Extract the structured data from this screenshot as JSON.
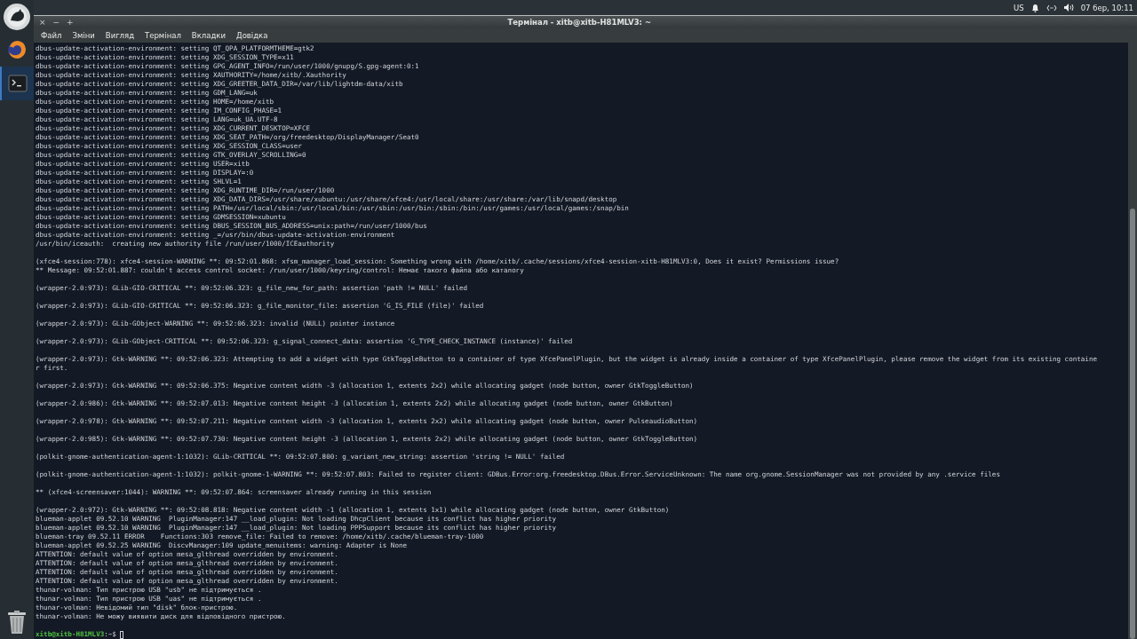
{
  "top_panel": {
    "keyboard_layout": "US",
    "clock": "07 бер, 10:11"
  },
  "dock": {
    "items": [
      {
        "kind": "logo",
        "selected": false
      },
      {
        "kind": "browser",
        "selected": false
      },
      {
        "kind": "terminal",
        "selected": true
      },
      {
        "kind": "trash",
        "selected": false
      }
    ]
  },
  "window": {
    "title": "Термінал - xitb@xitb-H81MLV3: ~",
    "controls": [
      "×",
      "−",
      "+"
    ],
    "menu": [
      "Файл",
      "Зміни",
      "Вигляд",
      "Термінал",
      "Вкладки",
      "Довідка"
    ]
  },
  "terminal": {
    "output": [
      [
        "dbus-update-activation-environment: setting QT_QPA_PLATFORMTHEME=gtk2",
        "dbus-update-activation-environment: setting XDG_SESSION_TYPE=x11",
        "dbus-update-activation-environment: setting GPG_AGENT_INFO=/run/user/1000/gnupg/S.gpg-agent:0:1",
        "dbus-update-activation-environment: setting XAUTHORITY=/home/xitb/.Xauthority",
        "dbus-update-activation-environment: setting XDG_GREETER_DATA_DIR=/var/lib/lightdm-data/xitb",
        "dbus-update-activation-environment: setting GDM_LANG=uk",
        "dbus-update-activation-environment: setting HOME=/home/xitb",
        "dbus-update-activation-environment: setting IM_CONFIG_PHASE=1",
        "dbus-update-activation-environment: setting LANG=uk_UA.UTF-8",
        "dbus-update-activation-environment: setting XDG_CURRENT_DESKTOP=XFCE",
        "dbus-update-activation-environment: setting XDG_SEAT_PATH=/org/freedesktop/DisplayManager/Seat0",
        "dbus-update-activation-environment: setting XDG_SESSION_CLASS=user",
        "dbus-update-activation-environment: setting GTK_OVERLAY_SCROLLING=0",
        "dbus-update-activation-environment: setting USER=xitb",
        "dbus-update-activation-environment: setting DISPLAY=:0",
        "dbus-update-activation-environment: setting SHLVL=1",
        "dbus-update-activation-environment: setting XDG_RUNTIME_DIR=/run/user/1000",
        "dbus-update-activation-environment: setting XDG_DATA_DIRS=/usr/share/xubuntu:/usr/share/xfce4:/usr/local/share:/usr/share:/var/lib/snapd/desktop",
        "dbus-update-activation-environment: setting PATH=/usr/local/sbin:/usr/local/bin:/usr/sbin:/usr/bin:/sbin:/bin:/usr/games:/usr/local/games:/snap/bin",
        "dbus-update-activation-environment: setting GDMSESSION=xubuntu",
        "dbus-update-activation-environment: setting DBUS_SESSION_BUS_ADDRESS=unix:path=/run/user/1000/bus",
        "dbus-update-activation-environment: setting _=/usr/bin/dbus-update-activation-environment",
        "/usr/bin/iceauth:  creating new authority file /run/user/1000/ICEauthority"
      ],
      [
        "(xfce4-session:778): xfce4-session-WARNING **: 09:52:01.868: xfsm_manager_load_session: Something wrong with /home/xitb/.cache/sessions/xfce4-session-xitb-H81MLV3:0, Does it exist? Permissions issue?",
        "** Message: 09:52:01.887: couldn't access control socket: /run/user/1000/keyring/control: Немає такого файла або каталогу"
      ],
      [
        "(wrapper-2.0:973): GLib-GIO-CRITICAL **: 09:52:06.323: g_file_new_for_path: assertion 'path != NULL' failed"
      ],
      [
        "(wrapper-2.0:973): GLib-GIO-CRITICAL **: 09:52:06.323: g_file_monitor_file: assertion 'G_IS_FILE (file)' failed"
      ],
      [
        "(wrapper-2.0:973): GLib-GObject-WARNING **: 09:52:06.323: invalid (NULL) pointer instance"
      ],
      [
        "(wrapper-2.0:973): GLib-GObject-CRITICAL **: 09:52:06.323: g_signal_connect_data: assertion 'G_TYPE_CHECK_INSTANCE (instance)' failed"
      ],
      [
        "(wrapper-2.0:973): Gtk-WARNING **: 09:52:06.323: Attempting to add a widget with type GtkToggleButton to a container of type XfcePanelPlugin, but the widget is already inside a container of type XfcePanelPlugin, please remove the widget from its existing containe",
        "r first."
      ],
      [
        "(wrapper-2.0:973): Gtk-WARNING **: 09:52:06.375: Negative content width -3 (allocation 1, extents 2x2) while allocating gadget (node button, owner GtkToggleButton)"
      ],
      [
        "(wrapper-2.0:986): Gtk-WARNING **: 09:52:07.013: Negative content height -3 (allocation 1, extents 2x2) while allocating gadget (node button, owner GtkButton)"
      ],
      [
        "(wrapper-2.0:978): Gtk-WARNING **: 09:52:07.211: Negative content width -3 (allocation 1, extents 2x2) while allocating gadget (node button, owner PulseaudioButton)"
      ],
      [
        "(wrapper-2.0:985): Gtk-WARNING **: 09:52:07.730: Negative content height -3 (allocation 1, extents 2x2) while allocating gadget (node button, owner GtkToggleButton)"
      ],
      [
        "(polkit-gnome-authentication-agent-1:1032): GLib-CRITICAL **: 09:52:07.800: g_variant_new_string: assertion 'string != NULL' failed"
      ],
      [
        "(polkit-gnome-authentication-agent-1:1032): polkit-gnome-1-WARNING **: 09:52:07.803: Failed to register client: GDBus.Error:org.freedesktop.DBus.Error.ServiceUnknown: The name org.gnome.SessionManager was not provided by any .service files"
      ],
      [
        "** (xfce4-screensaver:1044): WARNING **: 09:52:07.864: screensaver already running in this session"
      ],
      [
        "(wrapper-2.0:972): Gtk-WARNING **: 09:52:08.818: Negative content width -1 (allocation 1, extents 1x1) while allocating gadget (node button, owner GtkButton)",
        "blueman-applet 09.52.10 WARNING  PluginManager:147 __load_plugin: Not loading DhcpClient because its conflict has higher priority",
        "blueman-applet 09.52.10 WARNING  PluginManager:147 __load_plugin: Not loading PPPSupport because its conflict has higher priority",
        "blueman-tray 09.52.11 ERROR    Functions:303 remove_file: Failed to remove: /home/xitb/.cache/blueman-tray-1000",
        "blueman-applet 09.52.25 WARNING  DiscvManager:109 update_menuitems: warning: Adapter is None",
        "ATTENTION: default value of option mesa_glthread overridden by environment.",
        "ATTENTION: default value of option mesa_glthread overridden by environment.",
        "ATTENTION: default value of option mesa_glthread overridden by environment.",
        "ATTENTION: default value of option mesa_glthread overridden by environment.",
        "thunar-volman: Тип пристрою USB \"usb\" не підтримується .",
        "thunar-volman: Тип пристрою USB \"uas\" не підтримується .",
        "thunar-volman: Невідомий тип \"disk\" блок-пристрою.",
        "thunar-volman: Не можу виявити диск для відповідного пристрою."
      ]
    ],
    "prompt": {
      "user_host": "xitb@xitb-H81MLV3",
      "path": ":~$"
    }
  }
}
